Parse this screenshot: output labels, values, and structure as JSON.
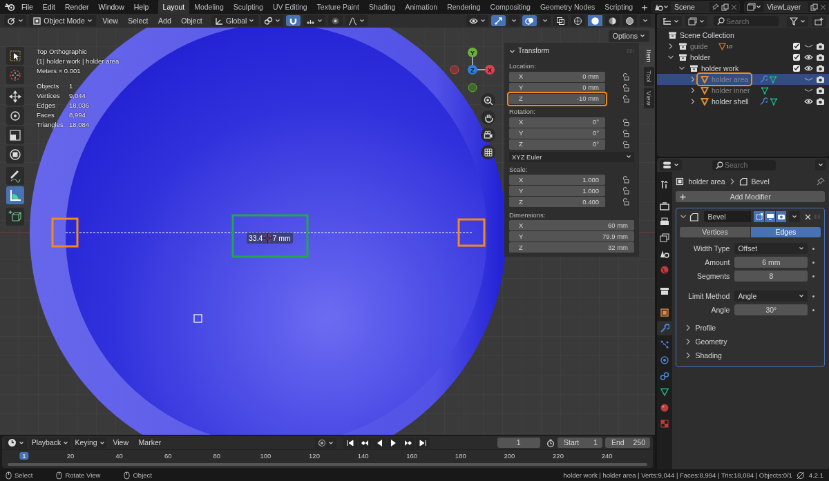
{
  "top_menu": [
    "File",
    "Edit",
    "Render",
    "Window",
    "Help"
  ],
  "workspaces": [
    {
      "label": "Layout",
      "selected": true
    },
    {
      "label": "Modeling",
      "selected": false
    },
    {
      "label": "Sculpting",
      "selected": false
    },
    {
      "label": "UV Editing",
      "selected": false
    },
    {
      "label": "Texture Paint",
      "selected": false
    },
    {
      "label": "Shading",
      "selected": false
    },
    {
      "label": "Animation",
      "selected": false
    },
    {
      "label": "Rendering",
      "selected": false
    },
    {
      "label": "Compositing",
      "selected": false
    },
    {
      "label": "Geometry Nodes",
      "selected": false
    },
    {
      "label": "Scripting",
      "selected": false
    }
  ],
  "scene": "Scene",
  "view_layer": "ViewLayer",
  "viewport": {
    "mode": "Object Mode",
    "menus": [
      "View",
      "Select",
      "Add",
      "Object"
    ],
    "orientation": "Global",
    "options": "Options",
    "info": [
      "Top Orthographic",
      "(1) holder work | holder area",
      "Meters × 0.001"
    ],
    "stats": [
      {
        "label": "Objects",
        "value": "1"
      },
      {
        "label": "Vertices",
        "value": "9,044"
      },
      {
        "label": "Edges",
        "value": "18,036"
      },
      {
        "label": "Faces",
        "value": "8,994"
      },
      {
        "label": "Triangles",
        "value": "18,084"
      }
    ],
    "tools": [
      {
        "kind": "select",
        "selected": false
      },
      {
        "kind": "cursor",
        "selected": false
      },
      {
        "kind": "move",
        "selected": false
      },
      {
        "kind": "rotate",
        "selected": false
      },
      {
        "kind": "scale",
        "selected": false
      },
      {
        "kind": "transform",
        "selected": false
      },
      {
        "kind": "annotate",
        "selected": false
      },
      {
        "kind": "measure",
        "selected": true
      },
      {
        "kind": "add-cube",
        "selected": false
      }
    ],
    "gizmo": [
      "Y",
      "Z",
      "X"
    ],
    "measurement": {
      "before": "33.4",
      "after": "7 mm",
      "highlighted": true,
      "ends_highlighted": true
    }
  },
  "sidebar": {
    "tabs": [
      {
        "label": "Item",
        "selected": true
      },
      {
        "label": "Tool",
        "selected": false
      },
      {
        "label": "View",
        "selected": false
      }
    ],
    "title": "Transform",
    "groups": [
      {
        "label": "Location:",
        "locks": true,
        "rows": [
          {
            "axis": "X",
            "value": "0 mm",
            "highlighted": false
          },
          {
            "axis": "Y",
            "value": "0 mm",
            "highlighted": false
          },
          {
            "axis": "Z",
            "value": "-10 mm",
            "highlighted": true
          }
        ]
      },
      {
        "label": "Rotation:",
        "locks": true,
        "mode": "XYZ Euler",
        "rows": [
          {
            "axis": "X",
            "value": "0°",
            "highlighted": false
          },
          {
            "axis": "Y",
            "value": "0°",
            "highlighted": false
          },
          {
            "axis": "Z",
            "value": "0°",
            "highlighted": false
          }
        ]
      },
      {
        "label": "Scale:",
        "locks": true,
        "rows": [
          {
            "axis": "X",
            "value": "1.000",
            "highlighted": false
          },
          {
            "axis": "Y",
            "value": "1.000",
            "highlighted": false
          },
          {
            "axis": "Z",
            "value": "0.400",
            "highlighted": false
          }
        ]
      },
      {
        "label": "Dimensions:",
        "locks": false,
        "rows": [
          {
            "axis": "X",
            "value": "60 mm",
            "highlighted": false
          },
          {
            "axis": "Y",
            "value": "79.9 mm",
            "highlighted": false
          },
          {
            "axis": "Z",
            "value": "32 mm",
            "highlighted": false
          }
        ]
      }
    ]
  },
  "outliner": {
    "placeholder": "Search",
    "tree": [
      {
        "label": "Scene Collection",
        "kind": "collection",
        "selected": false,
        "dimmed": false,
        "highlighted": false,
        "children": [
          {
            "label": "guide",
            "kind": "collection",
            "expanded": false,
            "selected": false,
            "dimmed": true,
            "highlighted": false,
            "badge": "10",
            "checked": true,
            "visible": false
          },
          {
            "label": "holder",
            "kind": "collection",
            "expanded": true,
            "selected": false,
            "dimmed": false,
            "highlighted": false,
            "checked": true,
            "visible": true,
            "children": [
              {
                "label": "holder work",
                "kind": "collection",
                "expanded": true,
                "selected": false,
                "dimmed": false,
                "highlighted": false,
                "checked": true,
                "visible": true,
                "children": [
                  {
                    "label": "holder area",
                    "kind": "object",
                    "expanded": false,
                    "selected": true,
                    "dimmed": true,
                    "highlighted": true,
                    "modifiers": true,
                    "visible": false
                  },
                  {
                    "label": "holder inner",
                    "kind": "object",
                    "expanded": false,
                    "selected": false,
                    "dimmed": true,
                    "highlighted": false,
                    "modifiers": false,
                    "visible": false
                  },
                  {
                    "label": "holder shell",
                    "kind": "object",
                    "expanded": false,
                    "selected": false,
                    "dimmed": false,
                    "highlighted": false,
                    "modifiers": true,
                    "visible": true
                  }
                ]
              }
            ]
          }
        ]
      }
    ]
  },
  "properties": {
    "placeholder": "Search",
    "breadcrumb": [
      "holder area",
      "Bevel"
    ],
    "add_modifier": "Add Modifier",
    "tabs": [
      {
        "kind": "tool",
        "selected": false
      },
      {
        "kind": "render",
        "selected": false
      },
      {
        "kind": "output",
        "selected": false
      },
      {
        "kind": "view-layer",
        "selected": false
      },
      {
        "kind": "scene",
        "selected": false
      },
      {
        "kind": "world",
        "selected": false
      },
      {
        "kind": "collection",
        "selected": false
      },
      {
        "kind": "object",
        "selected": false
      },
      {
        "kind": "modifiers",
        "selected": true
      },
      {
        "kind": "particles",
        "selected": false
      },
      {
        "kind": "physics",
        "selected": false
      },
      {
        "kind": "constraints",
        "selected": false
      },
      {
        "kind": "data",
        "selected": false
      },
      {
        "kind": "material",
        "selected": false
      },
      {
        "kind": "texture",
        "selected": false
      }
    ],
    "modifier": {
      "name": "Bevel",
      "expanded": true,
      "affect": [
        {
          "label": "Vertices",
          "selected": false
        },
        {
          "label": "Edges",
          "selected": true
        }
      ],
      "field_groups": [
        [
          {
            "label": "Width Type",
            "value": "Offset",
            "kind": "dropdown"
          },
          {
            "label": "Amount",
            "value": "6 mm",
            "kind": "number"
          },
          {
            "label": "Segments",
            "value": "8",
            "kind": "number"
          }
        ],
        [
          {
            "label": "Limit Method",
            "value": "Angle",
            "kind": "dropdown"
          },
          {
            "label": "Angle",
            "value": "30°",
            "kind": "number"
          }
        ]
      ],
      "subpanels": [
        {
          "label": "Profile",
          "expanded": false
        },
        {
          "label": "Geometry",
          "expanded": false
        },
        {
          "label": "Shading",
          "expanded": false
        }
      ]
    }
  },
  "timeline": {
    "menus": [
      "Playback",
      "Keying",
      "View",
      "Marker"
    ],
    "auto_keying": false,
    "frame": "1",
    "start_label": "Start",
    "start": "1",
    "end_label": "End",
    "end": "250",
    "ticks": [
      {
        "label": "1",
        "current": true
      },
      {
        "label": "20",
        "current": false
      },
      {
        "label": "40",
        "current": false
      },
      {
        "label": "60",
        "current": false
      },
      {
        "label": "80",
        "current": false
      },
      {
        "label": "100",
        "current": false
      },
      {
        "label": "120",
        "current": false
      },
      {
        "label": "140",
        "current": false
      },
      {
        "label": "160",
        "current": false
      },
      {
        "label": "180",
        "current": false
      },
      {
        "label": "200",
        "current": false
      },
      {
        "label": "220",
        "current": false
      },
      {
        "label": "240",
        "current": false
      }
    ]
  },
  "status": {
    "hints": [
      "Select",
      "Rotate View",
      "Object"
    ],
    "info": "holder work | holder area | Verts:9,044 | Faces:8,994 | Tris:18,084 | Objects:0/1",
    "version": "4.2.1"
  }
}
